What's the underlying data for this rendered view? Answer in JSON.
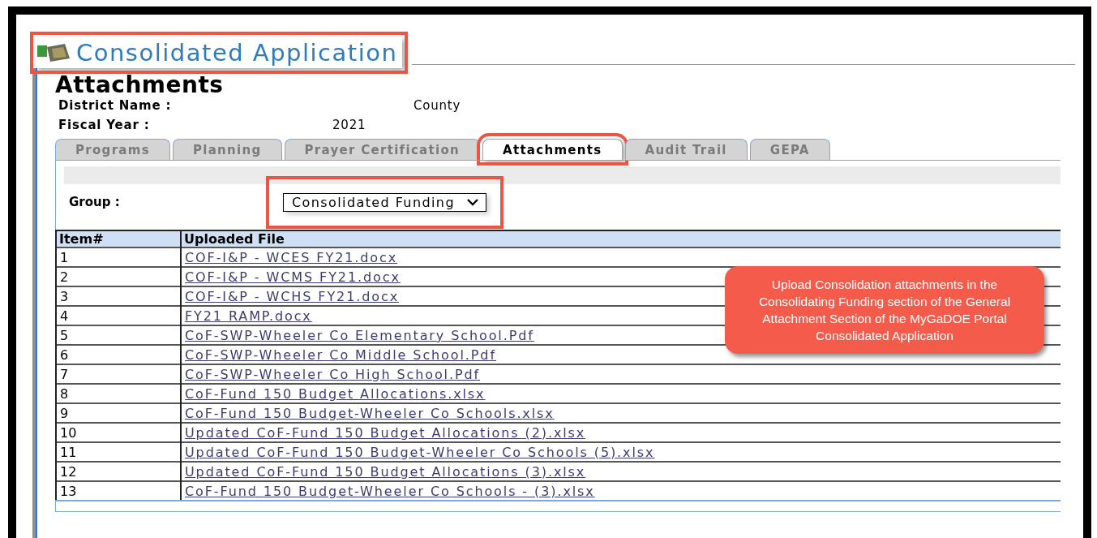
{
  "app_title": {
    "text": "Consolidated Application",
    "highlighted": true
  },
  "heading": "Attachments",
  "fields": [
    {
      "label": "District Name :",
      "value": "County"
    },
    {
      "label": "Fiscal Year :",
      "value": "2021"
    }
  ],
  "tabs": [
    {
      "label": "Programs",
      "selected": false,
      "highlighted": false
    },
    {
      "label": "Planning",
      "selected": false,
      "highlighted": false
    },
    {
      "label": "Prayer Certification",
      "selected": false,
      "highlighted": false
    },
    {
      "label": "Attachments",
      "selected": true,
      "highlighted": true
    },
    {
      "label": "Audit Trail",
      "selected": false,
      "highlighted": false
    },
    {
      "label": "GEPA",
      "selected": false,
      "highlighted": false
    }
  ],
  "group": {
    "label": "Group :",
    "value": "Consolidated Funding",
    "highlighted": true
  },
  "table": {
    "columns": [
      "Item#",
      "Uploaded File"
    ],
    "rows": [
      {
        "item": "1",
        "file": "COF-I&P - WCES FY21.docx"
      },
      {
        "item": "2",
        "file": "COF-I&P - WCMS FY21.docx"
      },
      {
        "item": "3",
        "file": "COF-I&P - WCHS FY21.docx"
      },
      {
        "item": "4",
        "file": "FY21 RAMP.docx"
      },
      {
        "item": "5",
        "file": "CoF-SWP-Wheeler Co Elementary School.Pdf"
      },
      {
        "item": "6",
        "file": "CoF-SWP-Wheeler Co Middle School.Pdf"
      },
      {
        "item": "7",
        "file": "CoF-SWP-Wheeler Co High School.Pdf"
      },
      {
        "item": "8",
        "file": "CoF-Fund 150 Budget Allocations.xlsx"
      },
      {
        "item": "9",
        "file": "CoF-Fund 150 Budget-Wheeler Co Schools.xlsx"
      },
      {
        "item": "10",
        "file": "Updated CoF-Fund 150 Budget Allocations (2).xlsx"
      },
      {
        "item": "11",
        "file": "Updated CoF-Fund 150 Budget-Wheeler Co Schools (5).xlsx"
      },
      {
        "item": "12",
        "file": "Updated CoF-Fund 150 Budget Allocations (3).xlsx"
      },
      {
        "item": "13",
        "file": "CoF-Fund 150 Budget-Wheeler Co Schools - (3).xlsx"
      }
    ]
  },
  "callout": "Upload Consolidation attachments in the Consolidating Funding section of the General Attachment Section of the MyGaDOE Portal Consolidated Application"
}
